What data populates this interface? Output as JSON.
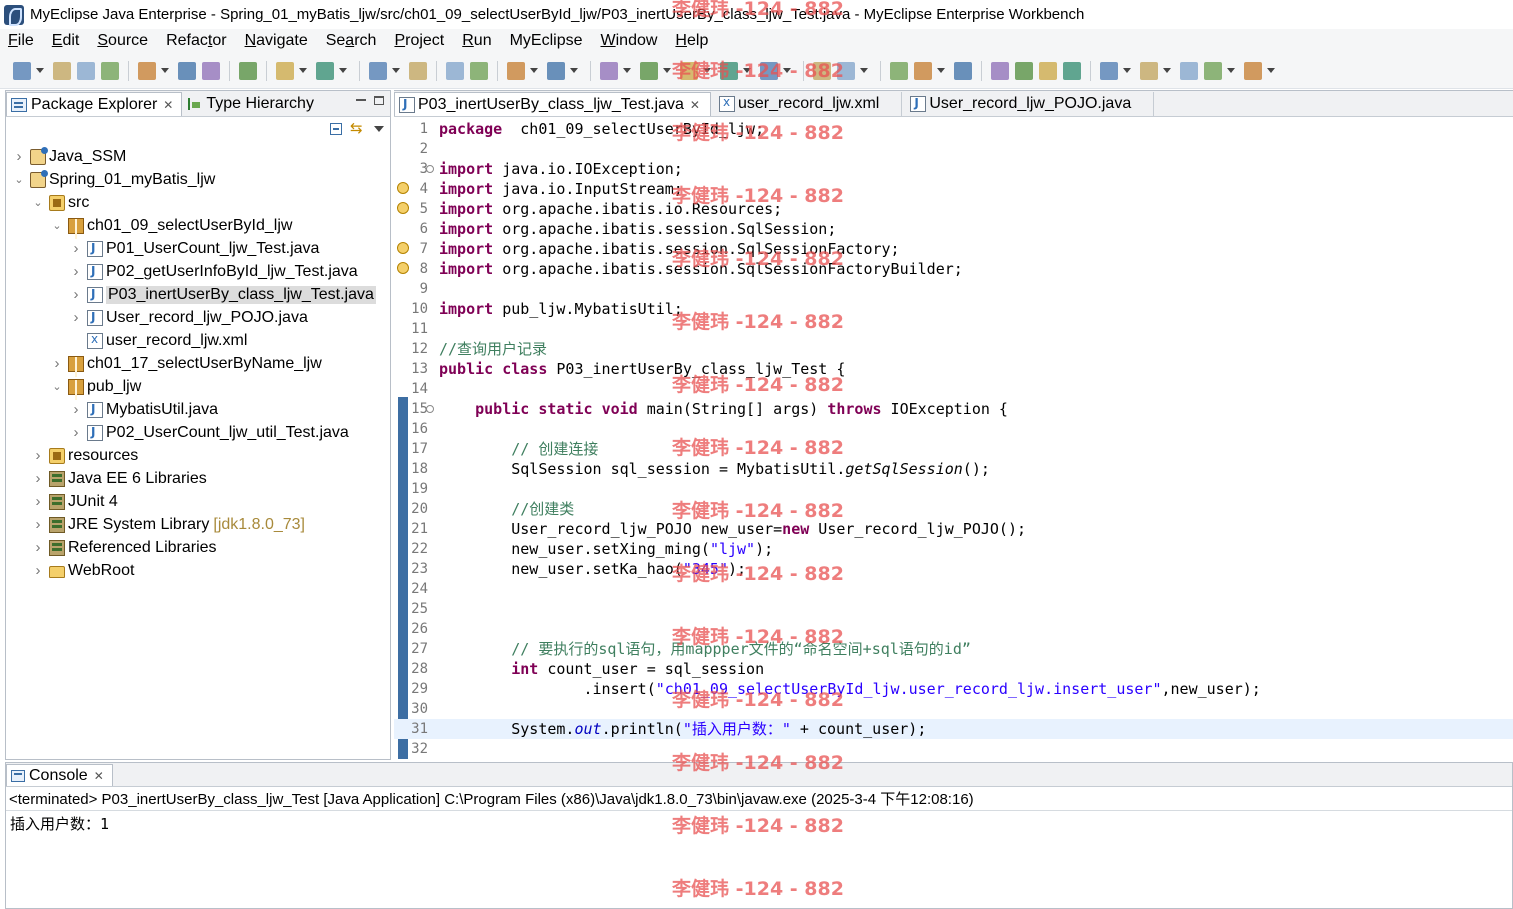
{
  "window": {
    "title": "MyEclipse Java Enterprise - Spring_01_myBatis_ljw/src/ch01_09_selectUserById_ljw/P03_inertUserBy_class_ljw_Test.java - MyEclipse Enterprise Workbench"
  },
  "menubar": [
    {
      "mn": "F",
      "rest": "ile"
    },
    {
      "mn": "E",
      "rest": "dit"
    },
    {
      "mn": "S",
      "rest": "ource"
    },
    {
      "pre": "Refac",
      "mn": "t",
      "rest": "or"
    },
    {
      "mn": "N",
      "rest": "avigate"
    },
    {
      "pre": "Se",
      "mn": "a",
      "rest": "rch"
    },
    {
      "mn": "P",
      "rest": "roject"
    },
    {
      "mn": "R",
      "rest": "un"
    },
    {
      "pre": "MyEclipse",
      "mn": "",
      "rest": ""
    },
    {
      "mn": "W",
      "rest": "indow"
    },
    {
      "mn": "H",
      "rest": "elp"
    }
  ],
  "left_pane": {
    "tabs": [
      "Package Explorer",
      "Type Hierarchy"
    ],
    "tree": [
      {
        "label": "Java_SSM",
        "icon": "project-icon",
        "depth": 0,
        "twisty": "closed"
      },
      {
        "label": "Spring_01_myBatis_ljw",
        "icon": "project-icon",
        "depth": 0,
        "twisty": "open"
      },
      {
        "label": "src",
        "icon": "source-folder-icon",
        "depth": 1,
        "twisty": "open"
      },
      {
        "label": "ch01_09_selectUserById_ljw",
        "icon": "package-icon",
        "depth": 2,
        "twisty": "open"
      },
      {
        "label": "P01_UserCount_ljw_Test.java",
        "icon": "java-file-icon",
        "depth": 3,
        "twisty": "closed"
      },
      {
        "label": "P02_getUserInfoById_ljw_Test.java",
        "icon": "java-file-icon",
        "depth": 3,
        "twisty": "closed"
      },
      {
        "label": "P03_inertUserBy_class_ljw_Test.java",
        "icon": "java-file-icon",
        "depth": 3,
        "twisty": "closed",
        "selected": true
      },
      {
        "label": "User_record_ljw_POJO.java",
        "icon": "java-file-icon",
        "depth": 3,
        "twisty": "closed"
      },
      {
        "label": "user_record_ljw.xml",
        "icon": "xml-file-icon",
        "depth": 3,
        "twisty": "none"
      },
      {
        "label": "ch01_17_selectUserByName_ljw",
        "icon": "package-icon",
        "depth": 2,
        "twisty": "closed"
      },
      {
        "label": "pub_ljw",
        "icon": "package-icon",
        "depth": 2,
        "twisty": "open"
      },
      {
        "label": "MybatisUtil.java",
        "icon": "java-file-icon",
        "depth": 3,
        "twisty": "closed"
      },
      {
        "label": "P02_UserCount_ljw_util_Test.java",
        "icon": "java-file-icon",
        "depth": 3,
        "twisty": "closed"
      },
      {
        "label": "resources",
        "icon": "source-folder-icon",
        "depth": 1,
        "twisty": "closed"
      },
      {
        "label": "Java EE 6 Libraries",
        "icon": "library-icon",
        "depth": 1,
        "twisty": "closed"
      },
      {
        "label": "JUnit 4",
        "icon": "library-icon",
        "depth": 1,
        "twisty": "closed"
      },
      {
        "label": "JRE System Library",
        "icon": "library-icon",
        "depth": 1,
        "twisty": "closed",
        "suffix": "[jdk1.8.0_73]"
      },
      {
        "label": "Referenced Libraries",
        "icon": "library-icon",
        "depth": 1,
        "twisty": "closed"
      },
      {
        "label": "WebRoot",
        "icon": "folder-icon",
        "depth": 1,
        "twisty": "closed"
      }
    ]
  },
  "editor": {
    "tabs": [
      {
        "label": "P03_inertUserBy_class_ljw_Test.java",
        "icon": "java-file-icon",
        "active": true,
        "closable": true
      },
      {
        "label": "user_record_ljw.xml",
        "icon": "xml-file-icon"
      },
      {
        "label": "User_record_ljw_POJO.java",
        "icon": "java-file-icon"
      }
    ],
    "current_line": 31,
    "lines": [
      {
        "n": "1",
        "segs": [
          [
            "kw",
            "package"
          ],
          [
            "",
            "  ch01_09_selectUserById_ljw;"
          ]
        ]
      },
      {
        "n": "2",
        "segs": []
      },
      {
        "n": "3",
        "fold": true,
        "segs": [
          [
            "kw",
            "import"
          ],
          [
            "",
            " java.io.IOException;"
          ]
        ]
      },
      {
        "n": "4",
        "warn": true,
        "segs": [
          [
            "kw",
            "import"
          ],
          [
            "",
            " java.io.InputStream;"
          ]
        ]
      },
      {
        "n": "5",
        "warn": true,
        "segs": [
          [
            "kw",
            "import"
          ],
          [
            "",
            " org.apache.ibatis.io.Resources;"
          ]
        ]
      },
      {
        "n": "6",
        "segs": [
          [
            "kw",
            "import"
          ],
          [
            "",
            " org.apache.ibatis.session.SqlSession;"
          ]
        ]
      },
      {
        "n": "7",
        "warn": true,
        "segs": [
          [
            "kw",
            "import"
          ],
          [
            "",
            " org.apache.ibatis.session.SqlSessionFactory;"
          ]
        ]
      },
      {
        "n": "8",
        "warn": true,
        "segs": [
          [
            "kw",
            "import"
          ],
          [
            "",
            " org.apache.ibatis.session.SqlSessionFactoryBuilder;"
          ]
        ]
      },
      {
        "n": "9",
        "segs": []
      },
      {
        "n": "10",
        "segs": [
          [
            "kw",
            "import"
          ],
          [
            "",
            " pub_ljw.MybatisUtil;"
          ]
        ]
      },
      {
        "n": "11",
        "segs": []
      },
      {
        "n": "12",
        "segs": [
          [
            "cm",
            "//查询用户记录"
          ]
        ]
      },
      {
        "n": "13",
        "segs": [
          [
            "kw",
            "public"
          ],
          [
            "",
            " "
          ],
          [
            "kw",
            "class"
          ],
          [
            "",
            " P03_inertUserBy_class_ljw_Test {"
          ]
        ]
      },
      {
        "n": "14",
        "segs": []
      },
      {
        "n": "15",
        "fold": true,
        "segs": [
          [
            "",
            "    "
          ],
          [
            "kw",
            "public"
          ],
          [
            "",
            " "
          ],
          [
            "kw",
            "static"
          ],
          [
            "",
            " "
          ],
          [
            "kw",
            "void"
          ],
          [
            "",
            " main(String[] args) "
          ],
          [
            "kw",
            "throws"
          ],
          [
            "",
            " IOException {"
          ]
        ]
      },
      {
        "n": "16",
        "segs": []
      },
      {
        "n": "17",
        "segs": [
          [
            "",
            "        "
          ],
          [
            "cm",
            "// 创建连接"
          ]
        ]
      },
      {
        "n": "18",
        "segs": [
          [
            "",
            "        SqlSession sql_session = MybatisUtil."
          ],
          [
            "itl",
            "getSqlSession"
          ],
          [
            "",
            "();"
          ]
        ]
      },
      {
        "n": "19",
        "segs": []
      },
      {
        "n": "20",
        "segs": [
          [
            "",
            "        "
          ],
          [
            "cm",
            "//创建类"
          ]
        ]
      },
      {
        "n": "21",
        "segs": [
          [
            "",
            "        User_record_ljw_POJO new_user="
          ],
          [
            "kw",
            "new"
          ],
          [
            "",
            " User_record_ljw_POJO();"
          ]
        ]
      },
      {
        "n": "22",
        "segs": [
          [
            "",
            "        new_user.setXing_ming("
          ],
          [
            "str",
            "\"ljw\""
          ],
          [
            "",
            ");"
          ]
        ]
      },
      {
        "n": "23",
        "segs": [
          [
            "",
            "        new_user.setKa_hao("
          ],
          [
            "str",
            "\"345\""
          ],
          [
            "",
            ");"
          ]
        ]
      },
      {
        "n": "24",
        "segs": []
      },
      {
        "n": "25",
        "segs": []
      },
      {
        "n": "26",
        "segs": []
      },
      {
        "n": "27",
        "segs": [
          [
            "",
            "        "
          ],
          [
            "cm",
            "// 要执行的sql语句，用mappper文件的“命名空间+sql语句的id”"
          ]
        ]
      },
      {
        "n": "28",
        "segs": [
          [
            "",
            "        "
          ],
          [
            "kw",
            "int"
          ],
          [
            "",
            " count_user = sql_session"
          ]
        ]
      },
      {
        "n": "29",
        "segs": [
          [
            "",
            "                .insert("
          ],
          [
            "str",
            "\"ch01_09_selectUserById_ljw.user_record_ljw.insert_user\""
          ],
          [
            "",
            ",new_user);"
          ]
        ]
      },
      {
        "n": "30",
        "segs": []
      },
      {
        "n": "31",
        "segs": [
          [
            "",
            "        System."
          ],
          [
            "fld",
            "out"
          ],
          [
            "",
            ".println("
          ],
          [
            "str",
            "\"插入用户数：\""
          ],
          [
            "",
            " + count_user);"
          ]
        ]
      },
      {
        "n": "32",
        "segs": []
      }
    ]
  },
  "console": {
    "tab": "Console",
    "status": "<terminated> P03_inertUserBy_class_ljw_Test [Java Application] C:\\Program Files (x86)\\Java\\jdk1.8.0_73\\bin\\javaw.exe (2025-3-4 下午12:08:16)",
    "output": "插入用户数：1"
  },
  "watermark": {
    "text": "李健玮 -124 - 882"
  }
}
